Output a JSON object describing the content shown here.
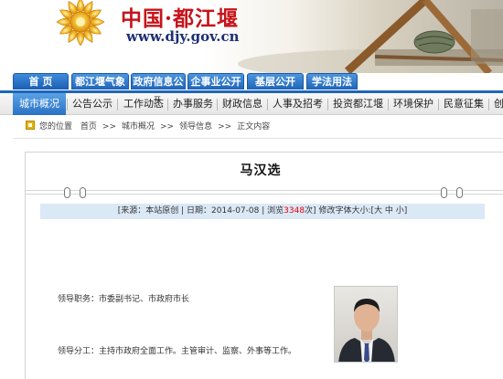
{
  "header": {
    "site_name": "中国·都江堰",
    "site_url": "www.djy.gov.cn"
  },
  "top_tabs": [
    {
      "label": "首 页"
    },
    {
      "label": "都江堰气象"
    },
    {
      "label": "政府信息公"
    },
    {
      "label": "企事业公开"
    },
    {
      "label": "基层公开"
    },
    {
      "label": "学法用法"
    }
  ],
  "main_nav": {
    "items": [
      {
        "label": "城市概况",
        "active": true
      },
      {
        "label": "公告公示"
      },
      {
        "label": "工作动态"
      },
      {
        "label": "办事服务"
      },
      {
        "label": "财政信息"
      },
      {
        "label": "人事及招考"
      },
      {
        "label": "投资都江堰"
      },
      {
        "label": "环境保护"
      },
      {
        "label": "民意征集"
      },
      {
        "label": "创"
      }
    ],
    "overlay_mark": "开"
  },
  "breadcrumb": {
    "prefix": "您的位置",
    "parts": [
      "首页",
      "城市概况",
      "领导信息",
      "正文内容"
    ],
    "separator": ">>"
  },
  "article": {
    "title": "马汉选",
    "meta": {
      "source": "[来源：本站原创",
      "date": "| 日期：2014-07-08",
      "views_label": "| 浏览",
      "views": "3348",
      "views_unit": "次]",
      "font_size": "修改字体大小:[大 中 小]"
    },
    "duty_line": "领导职务：市委副书记、市政府市长",
    "division_line": "领导分工：主持市政府全面工作。主管审计、监察、外事等工作。"
  },
  "colors": {
    "brand_red": "#c5141b",
    "nav_blue": "#1f65b8",
    "meta_bar": "#dbe8f6",
    "hits_red": "#e60000"
  }
}
